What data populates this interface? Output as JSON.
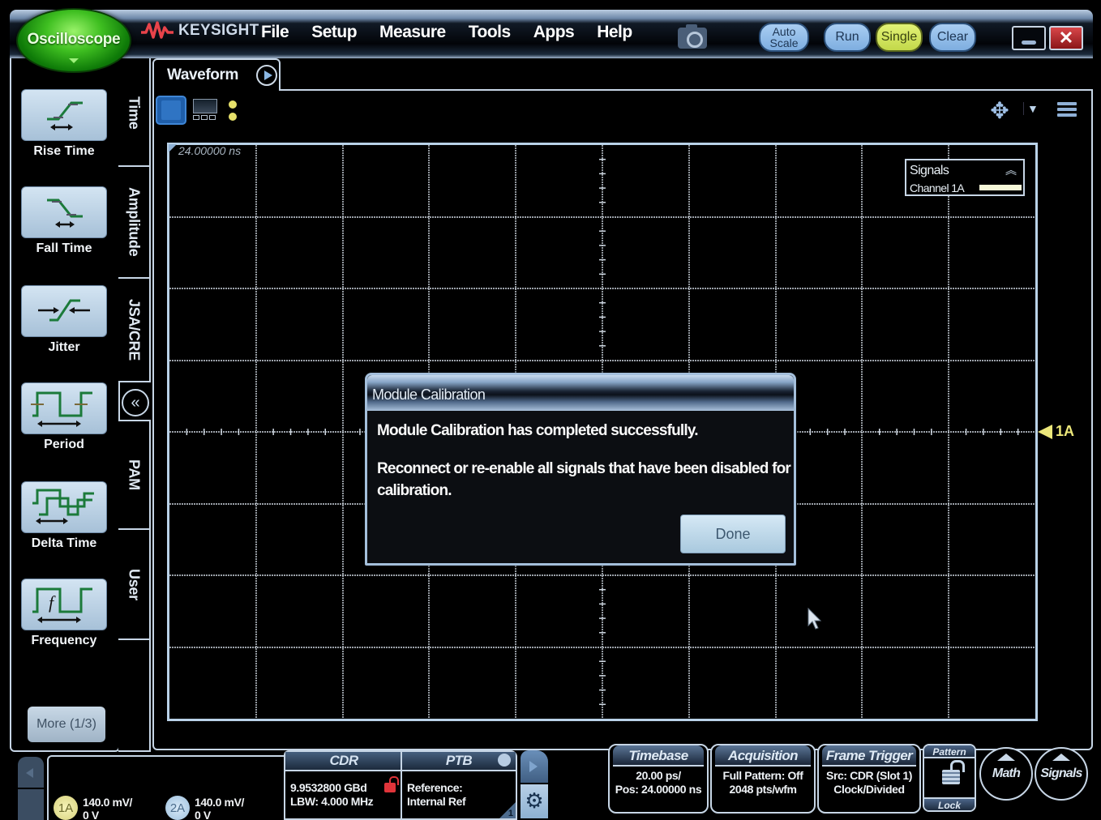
{
  "app": {
    "logo_label": "Oscilloscope",
    "brand": "KEYSIGHT",
    "menu": [
      "File",
      "Setup",
      "Measure",
      "Tools",
      "Apps",
      "Help"
    ],
    "buttons": {
      "auto_scale": "Auto Scale",
      "run": "Run",
      "single": "Single",
      "clear": "Clear",
      "close": "✕"
    },
    "colors": {
      "logo_green": "#3fbf21",
      "single_active": "#c3d84a",
      "pill_blue": "#7eaee0",
      "channel_1a": "#ece77a",
      "channel_2a": "#a9cbe6",
      "close_red": "#c2282b",
      "lock_red": "#e0343a"
    }
  },
  "left_panel": {
    "measurements": [
      {
        "label": "Rise Time",
        "icon": "rise-time-icon"
      },
      {
        "label": "Fall Time",
        "icon": "fall-time-icon"
      },
      {
        "label": "Jitter",
        "icon": "jitter-icon"
      },
      {
        "label": "Period",
        "icon": "period-icon"
      },
      {
        "label": "Delta Time",
        "icon": "delta-time-icon"
      },
      {
        "label": "Frequency",
        "icon": "frequency-icon"
      }
    ],
    "more_label": "More (1/3)",
    "tabs": [
      "Time",
      "Amplitude",
      "JSA/CRE",
      "PAM",
      "User"
    ],
    "active_tab": "Time",
    "collapse_glyph": "«"
  },
  "waveform": {
    "tab_label": "Waveform",
    "position_label": "24.00000 ns",
    "grid": {
      "columns": 10,
      "rows": 8
    },
    "signals_legend": {
      "title": "Signals",
      "channel": "Channel 1A",
      "collapse_glyph": "︽"
    },
    "channel_marker": "1A",
    "move_glyph": "✥",
    "dropdown_glyph": "▼"
  },
  "dialog": {
    "title": "Module Calibration",
    "message1": "Module Calibration has completed successfully.",
    "message2": "Reconnect or re-enable all signals that have been disabled for calibration.",
    "done_label": "Done"
  },
  "status_bar": {
    "channels": [
      {
        "id": "1A",
        "scale": "140.0 mV/",
        "offset": "0 V"
      },
      {
        "id": "2A",
        "scale": "140.0 mV/",
        "offset": "0 V"
      }
    ],
    "cdr": {
      "title": "CDR",
      "line1": "9.9532800 GBd",
      "line2": "LBW: 4.000 MHz"
    },
    "ptb": {
      "title": "PTB",
      "line1": "Reference:",
      "line2": "Internal Ref",
      "corner_num": "1"
    },
    "gear_glyph": "⚙",
    "timebase": {
      "title": "Timebase",
      "line1": "20.00 ps/",
      "line2": "Pos: 24.00000 ns"
    },
    "acquisition": {
      "title": "Acquisition",
      "line1": "Full Pattern: Off",
      "line2": "2048 pts/wfm"
    },
    "frame_trigger": {
      "title": "Frame Trigger",
      "line1": "Src: CDR (Slot 1)",
      "line2": "Clock/Divided"
    },
    "pattern_lock": {
      "top": "Pattern",
      "bottom": "Lock"
    },
    "math_label": "Math",
    "signals_label": "Signals"
  }
}
